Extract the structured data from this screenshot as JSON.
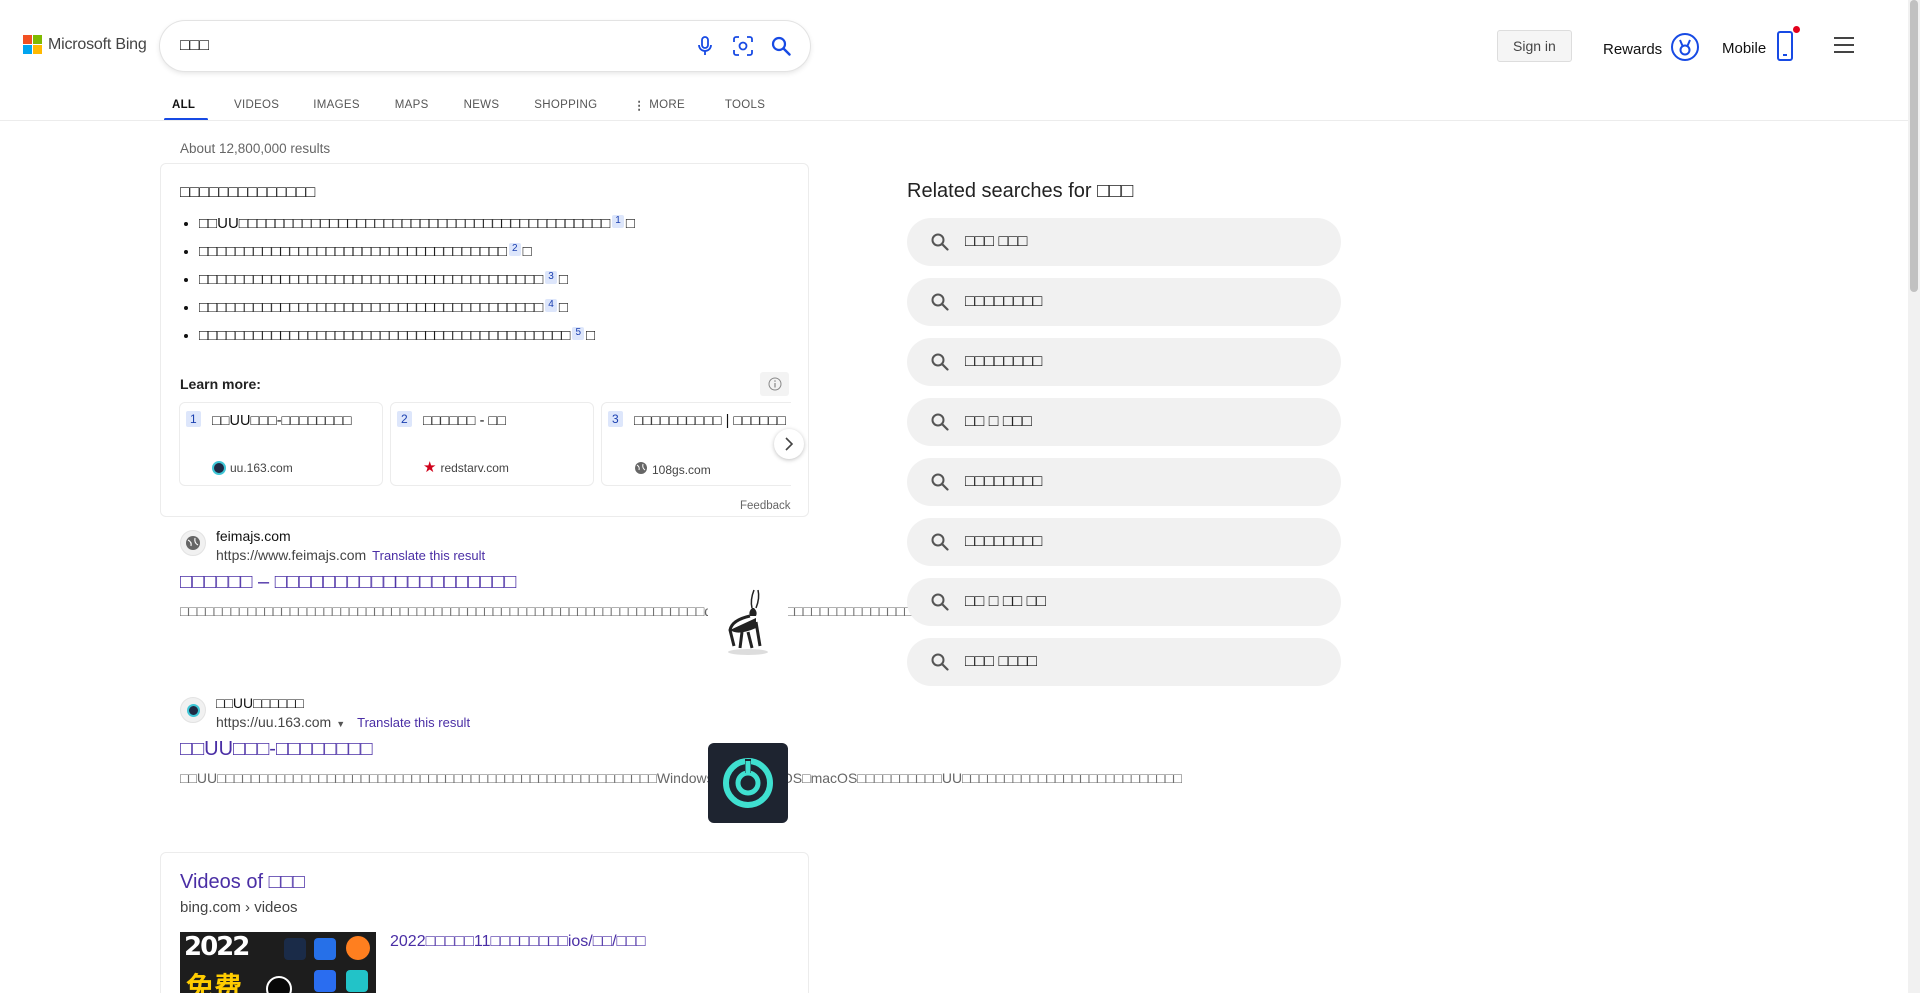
{
  "brand": {
    "logo_text": "Microsoft Bing",
    "logo_colors": [
      "#f25022",
      "#7fba00",
      "#00a4ef",
      "#ffb900"
    ]
  },
  "search": {
    "query": "□□□",
    "placeholder": ""
  },
  "header": {
    "signin_label": "Sign in",
    "rewards_label": "Rewards",
    "mobile_label": "Mobile",
    "accent_color": "#174ae4",
    "notification_dot_color": "#e3001b"
  },
  "tabs": [
    {
      "label": "ALL",
      "active": true
    },
    {
      "label": "VIDEOS"
    },
    {
      "label": "IMAGES"
    },
    {
      "label": "MAPS"
    },
    {
      "label": "NEWS"
    },
    {
      "label": "SHOPPING"
    },
    {
      "label": "MORE"
    },
    {
      "label": "TOOLS"
    }
  ],
  "result_count": "About 12,800,000 results",
  "answer": {
    "title": "□□□□□□□□□□□□□□",
    "bullets": [
      {
        "text": "□□UU□□□□□□□□□□□□□□□□□□□□□□□□□□□□□□□□□□□□□□□□□",
        "cite": "1",
        "end": "□"
      },
      {
        "text": "□□□□□□□□□□□□□□□□□□□□□□□□□□□□□□□□□□",
        "cite": "2",
        "end": "□"
      },
      {
        "text": "□□□□□□□□□□□□□□□□□□□□□□□□□□□□□□□□□□□□□□",
        "cite": "3",
        "end": "□"
      },
      {
        "text": "□□□□□□□□□□□□□□□□□□□□□□□□□□□□□□□□□□□□□□",
        "cite": "4",
        "end": "□"
      },
      {
        "text": "□□□□□□□□□□□□□□□□□□□□□□□□□□□□□□□□□□□□□□□□□",
        "cite": "5",
        "end": "□"
      }
    ],
    "learn_more_label": "Learn more:",
    "sources": [
      {
        "num": "1",
        "title": "□□UU□□□-□□□□□□□□",
        "domain": "uu.163.com"
      },
      {
        "num": "2",
        "title": "□□□□□□ - □□",
        "domain": "redstarv.com"
      },
      {
        "num": "3",
        "title": "□□□□□□□□□□ | □□□□□□",
        "domain": "108gs.com"
      }
    ],
    "feedback_label": "Feedback"
  },
  "results": [
    {
      "site": "feimajs.com",
      "url": "https://www.feimajs.com",
      "translate": "Translate this result",
      "title": "□□□□□□ – □□□□□□□□□□□□□□□□□□□□",
      "snippet": "□□□□□□□□□□□□□□□□□□□□□□□□□□□□□□□□□□□□□□□□□□□□□□□□□□□□□□□□□□□□□□dns□□□□□□□□□□□□□□□□□□□□□□□□"
    },
    {
      "site": "□□UU□□□□□□",
      "url": "https://uu.163.com",
      "translate": "Translate this result",
      "title": "□□UU□□□-□□□□□□□□",
      "snippet": "□□UU□□□□□□□□□□□□□□□□□□□□□□□□□□□□□□□□□□□□□□□□□□□□□□□□□□□□Windows□Android□iOS□macOS□□□□□□□□□□UU□□□□□□□□□□□□□□□□□□□□□□□□□□"
    }
  ],
  "videos": {
    "title": "Videos of □□□",
    "breadcrumb": "bing.com › videos",
    "thumb_text": "2022",
    "thumb_text_2": "免费",
    "first_title": "2022□□□□□11□□□□□□□□ios/□□/□□□"
  },
  "related": {
    "title": "Related searches for □□□",
    "items": [
      "□□□ □□□",
      "□□□□□□□□",
      "□□□□□□□□",
      "□□ □ □□□",
      "□□□□□□□□",
      "□□□□□□□□",
      "□□ □ □□ □□",
      "□□□ □□□□"
    ]
  }
}
